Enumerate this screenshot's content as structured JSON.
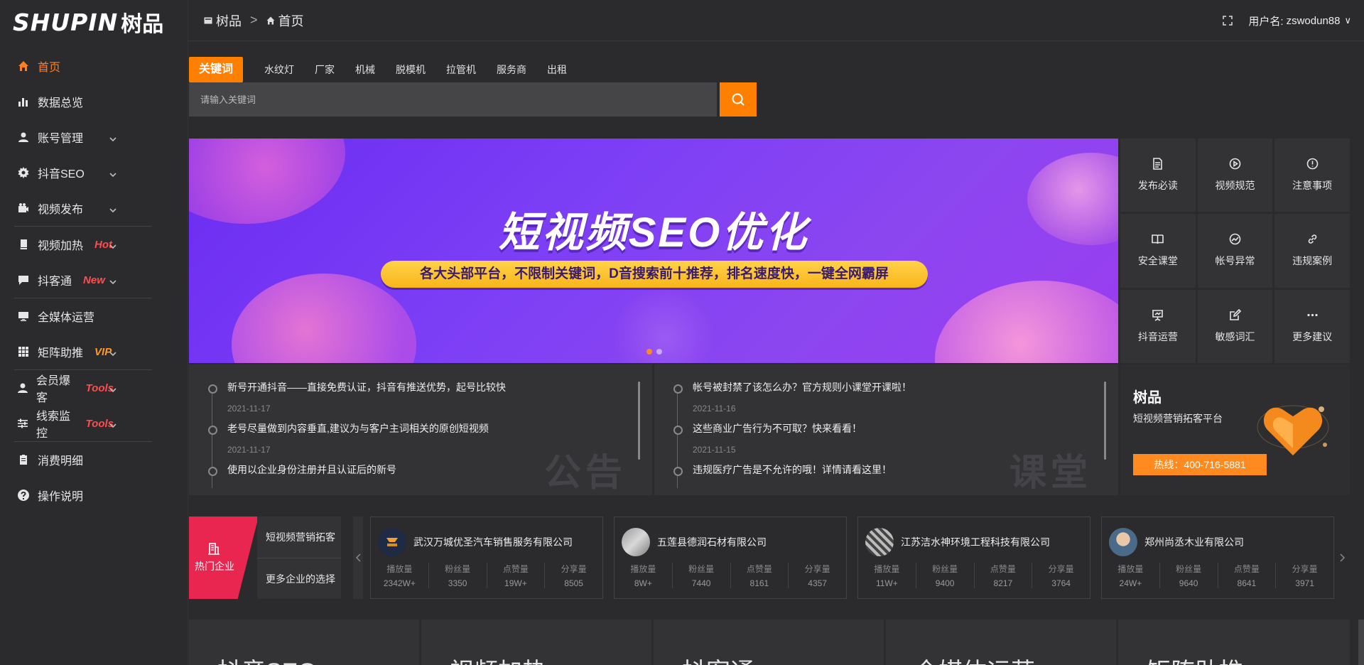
{
  "brand": {
    "logo_en": "SHUPIN",
    "logo_cn": "树品"
  },
  "sidebar": {
    "items": [
      {
        "label": "首页",
        "icon": "home-icon",
        "active": true
      },
      {
        "label": "数据总览",
        "icon": "bar-chart-icon"
      },
      {
        "label": "账号管理",
        "icon": "user-icon",
        "caret": true
      },
      {
        "label": "抖音SEO",
        "icon": "gear-icon",
        "caret": true
      },
      {
        "label": "视频发布",
        "icon": "video-icon",
        "caret": true
      },
      {
        "label": "视频加热",
        "icon": "book-icon",
        "caret": true,
        "tag": "Hot"
      },
      {
        "label": "抖客通",
        "icon": "chat-icon",
        "caret": true,
        "tag": "New"
      },
      {
        "label": "全媒体运营",
        "icon": "monitor-icon"
      },
      {
        "label": "矩阵助推",
        "icon": "grid-icon",
        "caret": true,
        "tag": "VIP"
      },
      {
        "label": "会员爆客",
        "icon": "user-icon",
        "caret": true,
        "tag": "Tools"
      },
      {
        "label": "线索监控",
        "icon": "sliders-icon",
        "caret": true,
        "tag": "Tools"
      },
      {
        "label": "消费明细",
        "icon": "clipboard-icon"
      },
      {
        "label": "操作说明",
        "icon": "help-icon"
      }
    ]
  },
  "header": {
    "crumb_root": "树品",
    "crumb_sep": ">",
    "crumb_current": "首页",
    "user_label": "用户名:",
    "username": "zswodun88",
    "user_caret": "∨"
  },
  "search": {
    "tabs": [
      "关键词",
      "水纹灯",
      "厂家",
      "机械",
      "脱模机",
      "拉管机",
      "服务商",
      "出租"
    ],
    "placeholder": "请输入关键词"
  },
  "banner": {
    "title": "短视频SEO优化",
    "subtitle": "各大头部平台，不限制关键词，D音搜索前十推荐，排名速度快，一键全网霸屏"
  },
  "shortcuts": [
    {
      "label": "发布必读",
      "icon": "document-icon"
    },
    {
      "label": "视频规范",
      "icon": "play-icon"
    },
    {
      "label": "注意事项",
      "icon": "alert-icon"
    },
    {
      "label": "安全课堂",
      "icon": "open-book-icon"
    },
    {
      "label": "帐号异常",
      "icon": "trend-icon"
    },
    {
      "label": "违规案例",
      "icon": "link-icon"
    },
    {
      "label": "抖音运营",
      "icon": "presentation-icon"
    },
    {
      "label": "敏感词汇",
      "icon": "edit-icon"
    },
    {
      "label": "更多建议",
      "icon": "more-icon"
    }
  ],
  "notices": {
    "watermark": "公告",
    "items": [
      {
        "title": "新号开通抖音——直接免费认证，抖音有推送优势，起号比较快",
        "date": "2021-11-17"
      },
      {
        "title": "老号尽量做到内容垂直,建议为与客户主词相关的原创短视频",
        "date": "2021-11-17"
      },
      {
        "title": "使用以企业身份注册并且认证后的新号",
        "date": ""
      }
    ]
  },
  "classroom": {
    "watermark": "课堂",
    "items": [
      {
        "title": "帐号被封禁了该怎么办？官方规则小课堂开课啦！",
        "date": "2021-11-16"
      },
      {
        "title": "这些商业广告行为不可取？快来看看！",
        "date": "2021-11-15"
      },
      {
        "title": "违规医疗广告是不允许的哦！详情请看这里！",
        "date": ""
      }
    ]
  },
  "brand_card": {
    "title": "树品",
    "subtitle": "短视频营销拓客平台",
    "hotline": "热线：400-716-5881"
  },
  "enterprise": {
    "hot_label": "热门企业",
    "links": [
      "短视频营销拓客",
      "更多企业的选择"
    ],
    "stat_labels": [
      "播放量",
      "粉丝量",
      "点赞量",
      "分享量"
    ],
    "cards": [
      {
        "name": "武汉万城优圣汽车销售服务有限公司",
        "avatar": "logo",
        "stats": [
          "2342W+",
          "3350",
          "19W+",
          "8505"
        ]
      },
      {
        "name": "五莲县德润石材有限公司",
        "avatar": "stone",
        "stats": [
          "8W+",
          "7440",
          "8161",
          "4357"
        ]
      },
      {
        "name": "江苏洁水神环境工程科技有限公司",
        "avatar": "machine",
        "stats": [
          "11W+",
          "9400",
          "8217",
          "3764"
        ]
      },
      {
        "name": "郑州尚丞木业有限公司",
        "avatar": "person",
        "stats": [
          "24W+",
          "9640",
          "8641",
          "3971"
        ]
      }
    ]
  },
  "tiles": [
    "抖音SEO",
    "视频加热",
    "抖客通",
    "全媒体运营",
    "矩阵助推"
  ],
  "colors": {
    "accent": "#ff7f00",
    "hot_tag": "#ff4d4d",
    "hot_enterprise": "#e8264f",
    "banner": "#7d3ff5"
  }
}
